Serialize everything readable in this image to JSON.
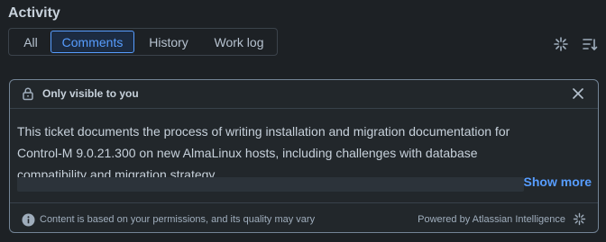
{
  "section": {
    "title": "Activity"
  },
  "tabs": [
    {
      "label": "All",
      "selected": false
    },
    {
      "label": "Comments",
      "selected": true
    },
    {
      "label": "History",
      "selected": false
    },
    {
      "label": "Work log",
      "selected": false
    }
  ],
  "toolbar": {
    "ai_icon": "sparkle-icon",
    "sort_icon": "sort-icon"
  },
  "summary_panel": {
    "visibility_label": "Only visible to you",
    "lock_icon": "lock-icon",
    "close_icon": "close-icon",
    "text": "This ticket documents the process of writing installation and migration documentation for Control-M 9.0.21.300 on new AlmaLinux hosts, including challenges with database compatibility and migration strategy.",
    "show_more_label": "Show more",
    "footer": {
      "disclaimer": "Content is based on your permissions, and its quality may vary",
      "powered_by": "Powered by Atlassian Intelligence",
      "info_icon": "info-icon",
      "ai_icon": "atlassian-intelligence-icon"
    }
  },
  "colors": {
    "background": "#1d2125",
    "panel_background": "#22272b",
    "accent": "#579dff",
    "text": "#c7d1db",
    "muted_text": "#9fadbc"
  }
}
